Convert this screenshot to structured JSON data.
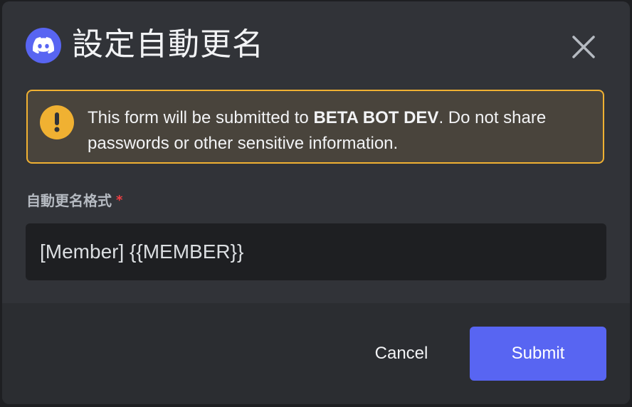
{
  "modal": {
    "title": "設定自動更名",
    "logo_icon": "discord-logo-icon",
    "close_icon": "close-icon"
  },
  "notice": {
    "icon": "exclamation-icon",
    "text_before": "This form will be submitted to ",
    "bot_name": "BETA BOT DEV",
    "text_after": ". Do not share passwords or other sensitive information."
  },
  "field": {
    "label": "自動更名格式",
    "required_mark": "*",
    "value": "[Member] {{MEMBER}}"
  },
  "footer": {
    "cancel_label": "Cancel",
    "submit_label": "Submit"
  },
  "colors": {
    "modal_bg": "#313338",
    "footer_bg": "#2b2d31",
    "brand": "#5865f2",
    "warning": "#f0b132",
    "warning_bg": "#49443c",
    "required": "#f23f43",
    "input_bg": "#1e1f22"
  }
}
